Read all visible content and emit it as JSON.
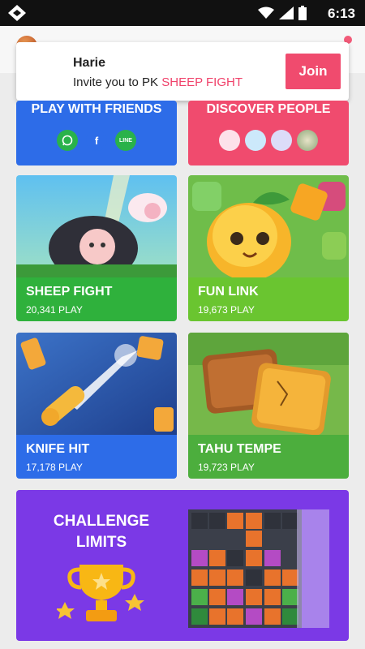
{
  "status_bar": {
    "time": "6:13"
  },
  "notification": {
    "name": "Harie",
    "message_prefix": "Invite you to PK ",
    "game_name": "SHEEP FIGHT",
    "join_label": "Join"
  },
  "friends": {
    "title": "PLAY WITH FRIENDS",
    "icons": [
      "whatsapp-icon",
      "facebook-icon",
      "line-icon"
    ],
    "facebook_glyph": "f",
    "line_glyph": "LINE"
  },
  "discover": {
    "title": "DISCOVER PEOPLE"
  },
  "games": [
    {
      "name": "SHEEP FIGHT",
      "plays": "20,341 PLAY",
      "color": "#2fb13c"
    },
    {
      "name": "FUN LINK",
      "plays": "19,673 PLAY",
      "color": "#6ac530"
    },
    {
      "name": "KNIFE HIT",
      "plays": "17,178 PLAY",
      "color": "#2d6ce8"
    },
    {
      "name": "TAHU TEMPE",
      "plays": "19,723 PLAY",
      "color": "#4cae3d"
    }
  ],
  "challenge": {
    "line1": "CHALLENGE",
    "line2": "LIMITS"
  },
  "colors": {
    "accent_pink": "#f04b6e",
    "blue": "#2d6ce8",
    "purple": "#7b39e6"
  }
}
